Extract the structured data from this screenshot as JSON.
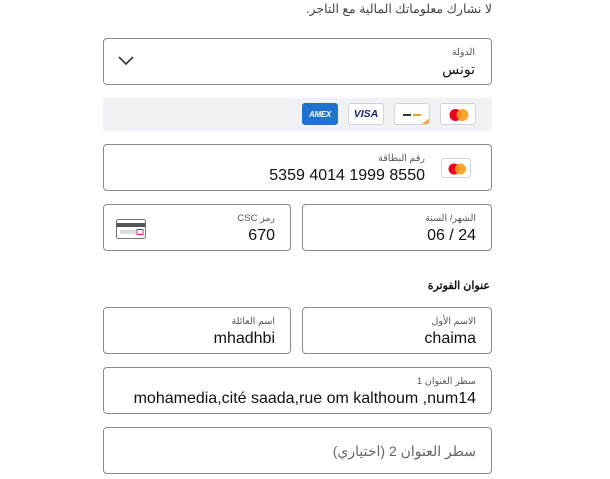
{
  "notice": "لا نشارك معلوماتك المالية مع التاجر.",
  "country": {
    "label": "الدولة",
    "value": "تونس"
  },
  "accepted_cards": [
    "amex-icon",
    "visa-icon",
    "discover-icon",
    "mastercard-icon"
  ],
  "card_brand_text": {
    "amex": "AMEX",
    "visa": "VISA"
  },
  "card_number": {
    "label": "رقم البطاقة",
    "value": "5359 4014 1999 8550"
  },
  "expiry": {
    "label": "الشهر/ السنة",
    "value": "06 / 24"
  },
  "csc": {
    "label": "رمز CSC",
    "value": "670"
  },
  "billing": {
    "title": "عنوان الفوترة",
    "first_name": {
      "label": "الاسم الأول",
      "value": "chaima"
    },
    "last_name": {
      "label": "اسم العائلة",
      "value": "mhadhbi"
    },
    "address1": {
      "label": "سطر العنوان 1",
      "value": "mohamedia,cité saada,rue om kalthoum ,num14"
    },
    "address2": {
      "placeholder": "سطر العنوان 2 (اختياري)"
    }
  },
  "colors": {
    "border": "#8a8a8a",
    "amex_blue": "#1f72cd",
    "visa_navy": "#1a1f71",
    "mc_red": "#eb001b",
    "mc_orange": "#f79e1b"
  }
}
